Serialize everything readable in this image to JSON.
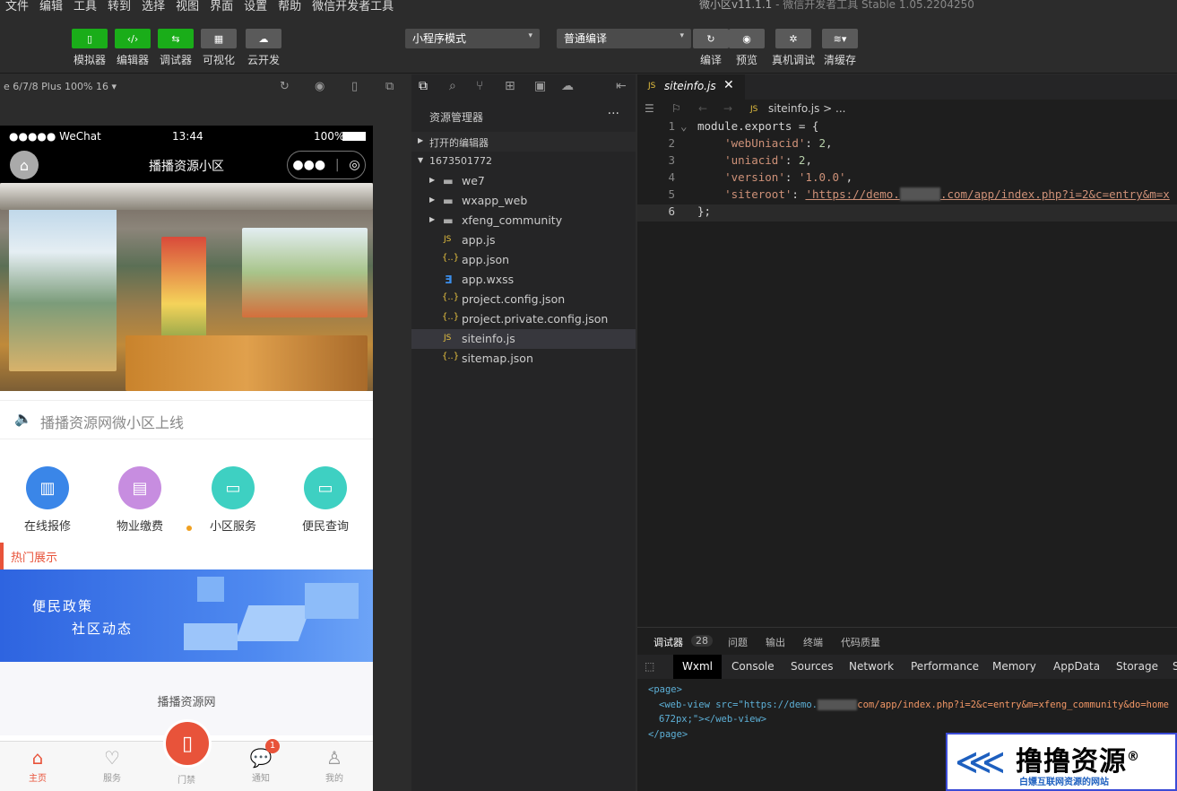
{
  "menu": [
    "文件",
    "编辑",
    "工具",
    "转到",
    "选择",
    "视图",
    "界面",
    "设置",
    "帮助",
    "微信开发者工具"
  ],
  "window_title": "微小区v11.1.1",
  "window_subtitle": " - 微信开发者工具 Stable 1.05.2204250",
  "toolbar": {
    "simulator": "模拟器",
    "editor": "编辑器",
    "debugger": "调试器",
    "visual": "可视化",
    "cloud": "云开发",
    "mode_select": "小程序模式",
    "compile_select": "普通编译",
    "compile": "编译",
    "preview": "预览",
    "real_debug": "真机调试",
    "clear_cache": "清缓存"
  },
  "sim": {
    "device": "e 6/7/8 Plus 100% 16 ▾",
    "status_signal": "●●●●● WeChat",
    "status_time": "13:44",
    "status_battery": "100%",
    "nav_title": "播播资源小区",
    "notice": "播播资源网微小区上线",
    "icons": [
      "在线报修",
      "物业缴费",
      "小区服务",
      "便民查询"
    ],
    "hot_title": "热门展示",
    "ad_line1": "便民政策",
    "ad_line2": "社区动态",
    "footer": "播播资源网",
    "tabs": [
      "主页",
      "服务",
      "门禁",
      "通知",
      "我的"
    ],
    "badge": "1",
    "colors": {
      "accent": "#e8533a",
      "toolbar_green": "#1aad19"
    }
  },
  "explorer": {
    "title": "资源管理器",
    "more": "···",
    "open_editors": "打开的编辑器",
    "root": "1673501772",
    "items": [
      {
        "name": "we7",
        "icon": "folder-icon"
      },
      {
        "name": "wxapp_web",
        "icon": "folder-icon"
      },
      {
        "name": "xfeng_community",
        "icon": "folder-icon"
      },
      {
        "name": "app.js",
        "icon": "js-icon"
      },
      {
        "name": "app.json",
        "icon": "json-icon"
      },
      {
        "name": "app.wxss",
        "icon": "wxss-icon"
      },
      {
        "name": "project.config.json",
        "icon": "json-icon"
      },
      {
        "name": "project.private.config.json",
        "icon": "json-icon"
      },
      {
        "name": "siteinfo.js",
        "icon": "js-icon"
      },
      {
        "name": "sitemap.json",
        "icon": "json-icon"
      }
    ]
  },
  "editor": {
    "tab": "siteinfo.js",
    "breadcrumb": "siteinfo.js > ...",
    "lines": [
      "1",
      "2",
      "3",
      "4",
      "5",
      "6"
    ],
    "code_l1": "module.exports = {",
    "code_l2_key": "'webUniacid'",
    "code_l2_val": "2",
    "code_l3_key": "'uniacid'",
    "code_l3_val": "2",
    "code_l4_key": "'version'",
    "code_l4_val": "'1.0.0'",
    "code_l5_key": "'siteroot'",
    "code_l5_val_a": "'https://demo.",
    "code_l5_val_b": ".com/app/index.php?i=2&c=entry&m=x",
    "code_l6": "};"
  },
  "debug": {
    "tabs": [
      "调试器",
      "问题",
      "输出",
      "终端",
      "代码质量"
    ],
    "count": "28",
    "panels": [
      "Wxml",
      "Console",
      "Sources",
      "Network",
      "Performance",
      "Memory",
      "AppData",
      "Storage",
      "S"
    ],
    "dom_line1": "<page>",
    "dom_line2_a": "<web-view src=\"https://demo.",
    "dom_line2_b": "com/app/index.php?i=2&c=entry&m=xfeng_community&do=home",
    "dom_line3": "672px;\"></web-view>",
    "dom_line4": "</page>"
  },
  "watermark": {
    "big": "撸撸资源",
    "small": "白嫖互联网资源的网站",
    "reg": "®"
  }
}
